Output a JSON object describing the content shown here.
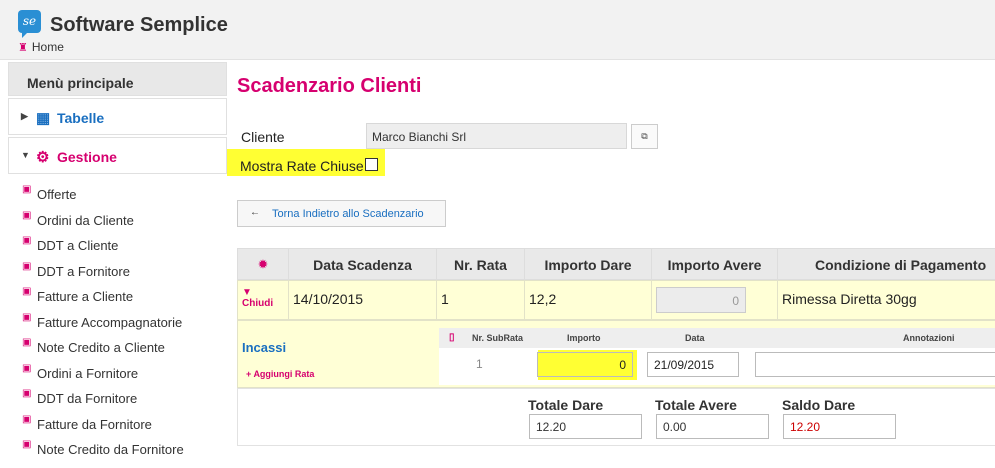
{
  "app": {
    "title": "Software Semplice",
    "logo_text": "se",
    "breadcrumb": "Home"
  },
  "sidebar": {
    "title": "Menù principale",
    "groups": [
      {
        "label": "Tabelle",
        "icon": "table-icon"
      },
      {
        "label": "Gestione",
        "icon": "gears-icon"
      }
    ],
    "items": [
      {
        "label": "Offerte"
      },
      {
        "label": "Ordini da Cliente"
      },
      {
        "label": "DDT a Cliente"
      },
      {
        "label": "DDT a Fornitore"
      },
      {
        "label": "Fatture a Cliente"
      },
      {
        "label": "Fatture Accompagnatorie"
      },
      {
        "label": "Note Credito a Cliente"
      },
      {
        "label": "Ordini a Fornitore"
      },
      {
        "label": "DDT da Fornitore"
      },
      {
        "label": "Fatture da Fornitore"
      },
      {
        "label": "Note Credito da Fornitore"
      }
    ]
  },
  "main": {
    "title": "Scadenzario Clienti",
    "cliente_label": "Cliente",
    "cliente_value": "Marco Bianchi Srl",
    "mostra_label": "Mostra Rate Chiuse",
    "back_label": "Torna Indietro allo Scadenzario"
  },
  "grid": {
    "headers": [
      "Data Scadenza",
      "Nr. Rata",
      "Importo Dare",
      "Importo Avere",
      "Condizione di Pagamento"
    ],
    "row": {
      "toggle_label": "Chiudi",
      "data": "14/10/2015",
      "nr_rata": "1",
      "importo_dare": "12,2",
      "importo_avere": "0",
      "condizione": "Rimessa Diretta 30gg"
    },
    "incassi": {
      "title": "Incassi",
      "add_label": "Aggiungi Rata",
      "headers": [
        "Nr. SubRata",
        "Importo",
        "Data",
        "Annotazioni"
      ],
      "subrata": {
        "nr": "1",
        "importo": "0",
        "data": "21/09/2015",
        "annotazioni": ""
      }
    },
    "totals": {
      "dare_label": "Totale Dare",
      "dare_value": "12.20",
      "avere_label": "Totale Avere",
      "avere_value": "0.00",
      "saldo_label": "Saldo Dare",
      "saldo_value": "12.20"
    }
  },
  "colors": {
    "accent": "#d6006f",
    "link": "#1a6fc0",
    "highlight": "#ffff33",
    "row_bg": "#ffffd6"
  }
}
